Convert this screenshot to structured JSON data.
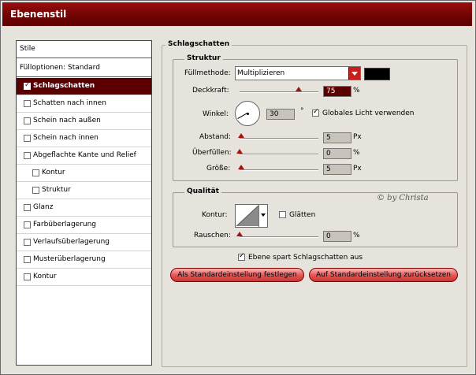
{
  "window": {
    "title": "Ebenenstil"
  },
  "left_panel": {
    "header": "Stile",
    "blend_options": "Fülloptionen: Standard",
    "items": [
      {
        "label": "Schlagschatten",
        "checked": true,
        "selected": true,
        "indent": false
      },
      {
        "label": "Schatten nach innen",
        "checked": false,
        "selected": false,
        "indent": false
      },
      {
        "label": "Schein nach außen",
        "checked": false,
        "selected": false,
        "indent": false
      },
      {
        "label": "Schein nach innen",
        "checked": false,
        "selected": false,
        "indent": false
      },
      {
        "label": "Abgeflachte Kante und Relief",
        "checked": false,
        "selected": false,
        "indent": false
      },
      {
        "label": "Kontur",
        "checked": false,
        "selected": false,
        "indent": true
      },
      {
        "label": "Struktur",
        "checked": false,
        "selected": false,
        "indent": true
      },
      {
        "label": "Glanz",
        "checked": false,
        "selected": false,
        "indent": false
      },
      {
        "label": "Farbüberlagerung",
        "checked": false,
        "selected": false,
        "indent": false
      },
      {
        "label": "Verlaufsüberlagerung",
        "checked": false,
        "selected": false,
        "indent": false
      },
      {
        "label": "Musterüberlagerung",
        "checked": false,
        "selected": false,
        "indent": false
      },
      {
        "label": "Kontur",
        "checked": false,
        "selected": false,
        "indent": false
      }
    ]
  },
  "main": {
    "section_title": "Schlagschatten",
    "structure": {
      "title": "Struktur",
      "blend_mode_label": "Füllmethode:",
      "blend_mode_value": "Multiplizieren",
      "shadow_color": "#000000",
      "opacity_label": "Deckkraft:",
      "opacity_value": "75",
      "opacity_unit": "%",
      "opacity_fraction": 0.75,
      "angle_label": "Winkel:",
      "angle_value": "30",
      "angle_unit": "°",
      "angle_degrees": 30,
      "global_light_label": "Globales Licht verwenden",
      "global_light_checked": true,
      "distance_label": "Abstand:",
      "distance_value": "5",
      "distance_unit": "Px",
      "distance_fraction": 0.02,
      "spread_label": "Überfüllen:",
      "spread_value": "0",
      "spread_unit": "%",
      "spread_fraction": 0,
      "size_label": "Größe:",
      "size_value": "5",
      "size_unit": "Px",
      "size_fraction": 0.02
    },
    "quality": {
      "title": "Qualität",
      "contour_label": "Kontur:",
      "antialias_label": "Glätten",
      "antialias_checked": false,
      "noise_label": "Rauschen:",
      "noise_value": "0",
      "noise_unit": "%",
      "noise_fraction": 0
    },
    "knockout_label": "Ebene spart Schlagschatten aus",
    "knockout_checked": true,
    "btn_make_default": "Als Standardeinstellung festlegen",
    "btn_reset_default": "Auf Standardeinstellung zurücksetzen",
    "watermark": "© by Christa"
  },
  "colors": {
    "accent": "#5a0000",
    "titlebar": "#800808",
    "button": "#e45a5a"
  }
}
